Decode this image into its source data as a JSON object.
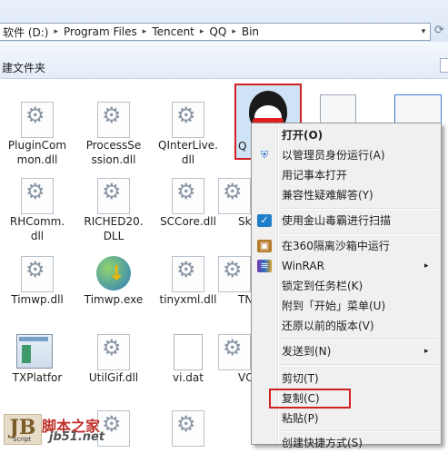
{
  "address": {
    "crumbs": [
      "软件 (D:)",
      "Program Files",
      "Tencent",
      "QQ",
      "Bin"
    ],
    "separator": "▸",
    "dropdown": "▾"
  },
  "toolbar": {
    "new_folder": "建文件夹"
  },
  "files": [
    {
      "name": "PluginCom\nmon.dll",
      "icon": "dll-gear-icon"
    },
    {
      "name": "ProcessSe\nssion.dll",
      "icon": "dll-gear-icon"
    },
    {
      "name": "QInterLive.\ndll",
      "icon": "dll-gear-icon"
    },
    {
      "name": "RHComm.\ndll",
      "icon": "dll-gear-icon"
    },
    {
      "name": "RICHED20.\nDLL",
      "icon": "dll-gear-icon"
    },
    {
      "name": "SCCore.dll",
      "icon": "dll-gear-icon"
    },
    {
      "name": "Sk",
      "icon": "dll-gear-icon"
    },
    {
      "name": "Timwp.dll",
      "icon": "dll-gear-icon"
    },
    {
      "name": "Timwp.exe",
      "icon": "globe-exe-icon"
    },
    {
      "name": "tinyxml.dll",
      "icon": "dll-gear-icon"
    },
    {
      "name": "TN",
      "icon": "dll-gear-icon"
    },
    {
      "name": "TXPlatfor",
      "icon": "window-app-icon"
    },
    {
      "name": "UtilGif.dll",
      "icon": "dll-gear-icon"
    },
    {
      "name": "vi.dat",
      "icon": "blank-file-icon"
    },
    {
      "name": "VC",
      "icon": "dll-gear-icon"
    },
    {
      "name": "Q",
      "icon": "qq-penguin-icon"
    }
  ],
  "context_menu": {
    "items": [
      {
        "label": "打开(O)",
        "bold": true
      },
      {
        "label": "以管理员身份运行(A)",
        "icon": "shield-icon"
      },
      {
        "label": "用记事本打开"
      },
      {
        "label": "兼容性疑难解答(Y)"
      },
      {
        "label": "使用金山毒霸进行扫描",
        "icon": "kingsoft-antivirus-icon"
      },
      {
        "label": "在360隔离沙箱中运行",
        "icon": "sandbox-360-icon"
      },
      {
        "label": "WinRAR",
        "icon": "winrar-icon",
        "submenu": true
      },
      {
        "label": "锁定到任务栏(K)"
      },
      {
        "label": "附到「开始」菜单(U)"
      },
      {
        "label": "还原以前的版本(V)"
      },
      {
        "label": "发送到(N)",
        "submenu": true
      },
      {
        "label": "剪切(T)"
      },
      {
        "label": "复制(C)",
        "highlighted_box": true
      },
      {
        "label": "粘贴(P)"
      },
      {
        "label": "创建快捷方式(S)"
      }
    ],
    "submenu_arrow": "▸"
  },
  "watermark": {
    "mark": "JB",
    "script": "Script",
    "name": "脚本之家",
    "url": "jb51.net"
  },
  "colors": {
    "highlight_border": "#d21f1f",
    "menu_bg": "#f0f0f0",
    "selection_bg": "#cfe3f7"
  }
}
